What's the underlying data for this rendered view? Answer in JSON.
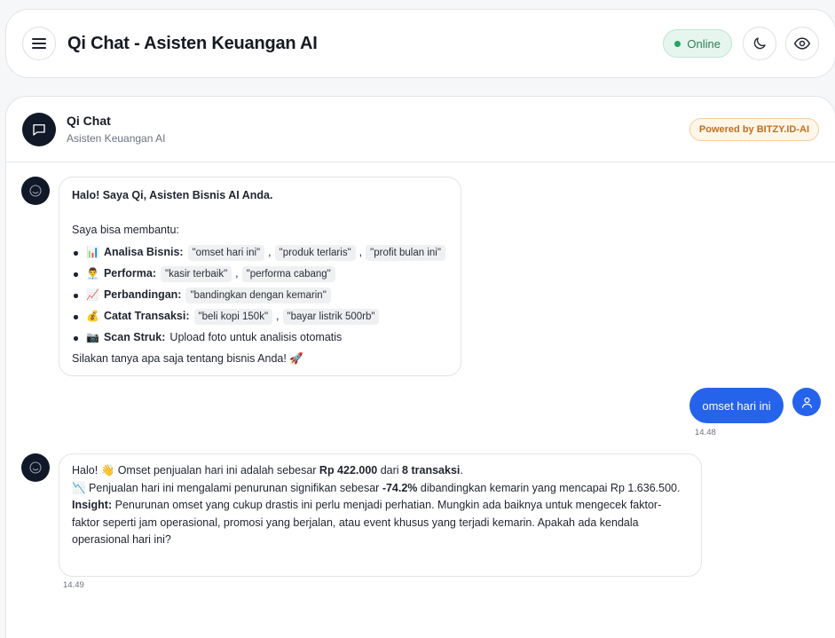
{
  "topbar": {
    "title": "Qi Chat - Asisten Keuangan AI",
    "status": "Online",
    "status_color": "#23a565"
  },
  "chat": {
    "name": "Qi Chat",
    "subtitle": "Asisten Keuangan AI",
    "powered_by": "Powered by BITZY.ID-AI"
  },
  "messages": {
    "welcome": {
      "intro": "Halo! Saya Qi, Asisten Bisnis AI Anda.",
      "help_label": "Saya bisa membantu:",
      "items": [
        {
          "emoji": "📊",
          "label": "Analisa Bisnis:",
          "chips": [
            "\"omset hari ini\"",
            "\"produk terlaris\"",
            "\"profit bulan ini\""
          ]
        },
        {
          "emoji": "👨‍💼",
          "label": "Performa:",
          "chips": [
            "\"kasir terbaik\"",
            "\"performa cabang\""
          ]
        },
        {
          "emoji": "📈",
          "label": "Perbandingan:",
          "chips": [
            "\"bandingkan dengan kemarin\""
          ]
        },
        {
          "emoji": "💰",
          "label": "Catat Transaksi:",
          "chips": [
            "\"beli kopi 150k\"",
            "\"bayar listrik 500rb\""
          ]
        },
        {
          "emoji": "📷",
          "label": "Scan Struk:",
          "text": "Upload foto untuk analisis otomatis"
        }
      ],
      "outro": "Silakan tanya apa saja tentang bisnis Anda! 🚀"
    },
    "user": {
      "text": "omset hari ini",
      "time": "14.48"
    },
    "reply": {
      "greeting": "Halo! 👋 Omset penjualan hari ini adalah sebesar ",
      "amount": "Rp 422.000",
      "from": " dari ",
      "tx": "8 transaksi",
      "end": ".",
      "line2_pre": "📉 Penjualan hari ini mengalami penurunan signifikan sebesar ",
      "pct": "-74.2%",
      "line2_post": " dibandingkan kemarin yang mencapai Rp 1.636.500.",
      "insight_label": "Insight:",
      "insight_text": " Penurunan omset yang cukup drastis ini perlu menjadi perhatian. Mungkin ada baiknya untuk mengecek faktor-faktor seperti jam operasional, promosi yang berjalan, atau event khusus yang terjadi kemarin. Apakah ada kendala operasional hari ini?",
      "time": "14.49"
    }
  },
  "colors": {
    "accent": "#2563eb",
    "bot_avatar": "#111827",
    "badge": "#c0701a"
  }
}
